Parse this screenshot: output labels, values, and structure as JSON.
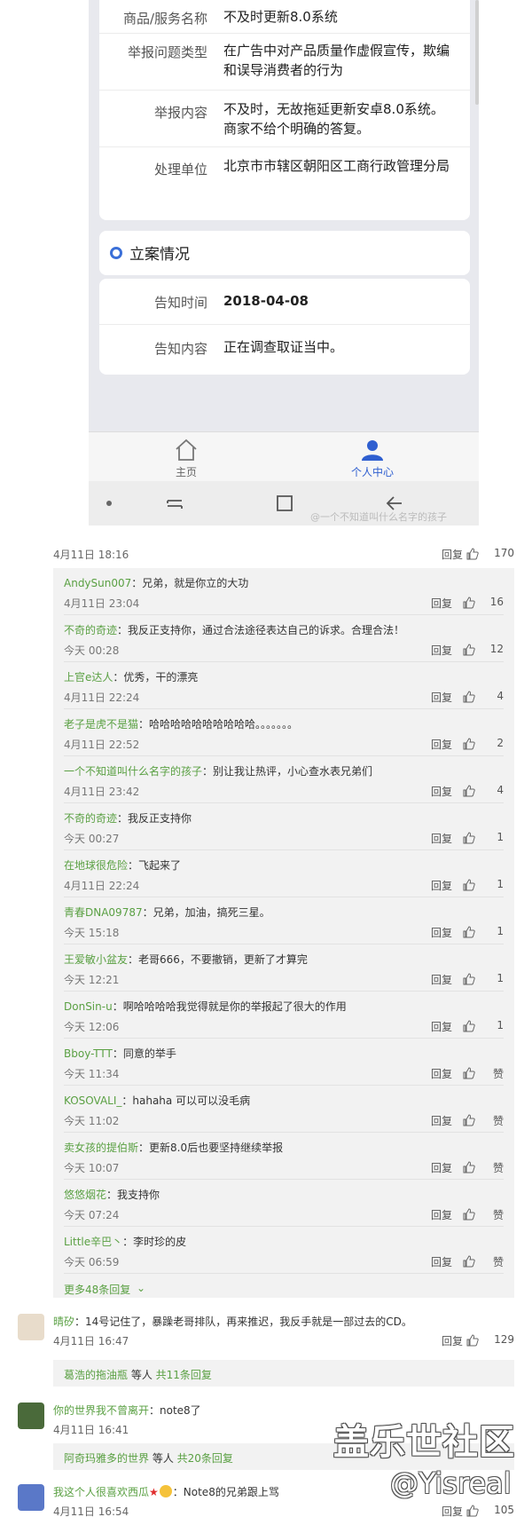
{
  "screenshot": {
    "report_rows": [
      {
        "label": "商品/服务名称",
        "value": "不及时更新8.0系统"
      },
      {
        "label": "举报问题类型",
        "value": "在广告中对产品质量作虚假宣传，欺编和误导消费者的行为"
      },
      {
        "label": "举报内容",
        "value": "不及时，无故拖延更新安卓8.0系统。商家不给个明确的答复。"
      },
      {
        "label": "处理单位",
        "value": "北京市市辖区朝阳区工商行政管理分局"
      }
    ],
    "case_section_title": "立案情况",
    "case_rows": [
      {
        "label": "告知时间",
        "value": "2018-04-08"
      },
      {
        "label": "告知内容",
        "value": "正在调查取证当中。"
      }
    ],
    "tabs": {
      "home": "主页",
      "me": "个人中心"
    },
    "watermark": "@一个不知道叫什么名字的孩子"
  },
  "post_meta": {
    "time": "4月11日 18:16",
    "reply": "回复",
    "likes": "170"
  },
  "replies": [
    {
      "user": "AndySun007",
      "text": "：兄弟，就是你立的大功",
      "time": "4月11日 23:04",
      "reply": "回复",
      "likes": "16"
    },
    {
      "user": "不奇的奇迹",
      "text": "：我反正支持你，通过合法途径表达自己的诉求。合理合法！",
      "time": "今天 00:28",
      "reply": "回复",
      "likes": "12"
    },
    {
      "user": "上官e达人",
      "text": "：优秀，干的漂亮",
      "time": "4月11日 22:24",
      "reply": "回复",
      "likes": "4"
    },
    {
      "user": "老子是虎不是猫",
      "text": "：哈哈哈哈哈哈哈哈哈哈。。。。。。。",
      "time": "4月11日 22:52",
      "reply": "回复",
      "likes": "2"
    },
    {
      "user": "一个不知道叫什么名字的孩子",
      "text": "：别让我让热评，小心查水表兄弟们",
      "time": "4月11日 23:42",
      "reply": "回复",
      "likes": "4"
    },
    {
      "user": "不奇的奇迹",
      "text": "：我反正支持你",
      "time": "今天 00:27",
      "reply": "回复",
      "likes": "1"
    },
    {
      "user": "在地球很危险",
      "text": "：飞起来了",
      "time": "4月11日 22:24",
      "reply": "回复",
      "likes": "1"
    },
    {
      "user": "青春DNA09787",
      "text": "：兄弟，加油，搞死三星。",
      "time": "今天 15:18",
      "reply": "回复",
      "likes": "1"
    },
    {
      "user": "王爱敏小盆友",
      "text": "：老哥666，不要撤销，更新了才算完",
      "time": "今天 12:21",
      "reply": "回复",
      "likes": "1"
    },
    {
      "user": "DonSin-u",
      "text": "：啊哈哈哈哈我觉得就是你的举报起了很大的作用",
      "time": "今天 12:06",
      "reply": "回复",
      "likes": "1"
    },
    {
      "user": "Bboy-TTT",
      "text": "：同意的举手",
      "time": "今天 11:34",
      "reply": "回复",
      "likes": "赞"
    },
    {
      "user": "KOSOVALI_",
      "text": "：hahaha 可以可以没毛病",
      "time": "今天 11:02",
      "reply": "回复",
      "likes": "赞"
    },
    {
      "user": "卖女孩的提伯斯",
      "text": "：更新8.0后也要坚持继续举报",
      "time": "今天 10:07",
      "reply": "回复",
      "likes": "赞"
    },
    {
      "user": "悠悠烟花",
      "text": "：我支持你",
      "time": "今天 07:24",
      "reply": "回复",
      "likes": "赞"
    },
    {
      "user": "Little辛巴丶",
      "text": "：李时珍的皮",
      "time": "今天 06:59",
      "reply": "回复",
      "likes": "赞"
    }
  ],
  "more_replies": "更多48条回复",
  "comments": [
    {
      "user": "晴矽",
      "text": "：14号记住了，暴躁老哥排队，再来推迟，我反手就是一部过去的CD。",
      "time": "4月11日 16:47",
      "reply": "回复",
      "likes": "129",
      "sub": {
        "user": "葛浩的拖油瓶",
        "mid": " 等人 ",
        "count": "共11条回复"
      }
    },
    {
      "user": "你的世界我不曾离开",
      "text": "：note8了",
      "time": "4月11日 16:41",
      "reply": "回复",
      "likes": "",
      "sub": {
        "user": "阿奇玛雅多的世界",
        "mid": " 等人 ",
        "count": "共20条回复"
      }
    },
    {
      "user": "我这个人很喜欢西瓜",
      "text": "：Note8的兄弟跟上骂",
      "time": "4月11日 16:54",
      "reply": "回复",
      "likes": "105"
    }
  ],
  "overlay_watermark": {
    "line1": "盖乐世社区",
    "line2": "@Yisreal"
  },
  "colors": {
    "username": "#5aa043",
    "accent": "#2f5fd0"
  }
}
